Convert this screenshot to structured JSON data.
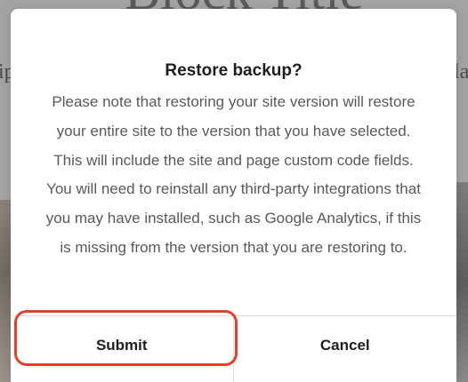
{
  "background": {
    "heading_fragment": "Block Title",
    "left_text_fragment": "ip",
    "right_text_fragment": "la"
  },
  "dialog": {
    "title": "Restore backup?",
    "message": "Please note that restoring your site version will restore your entire site to the version that you have selected. This will include the site and page custom code fields. You will need to reinstall any third-party integrations that you may have installed, such as Google Analytics, if this is missing from the version that you are restoring to.",
    "submit_label": "Submit",
    "cancel_label": "Cancel"
  },
  "colors": {
    "highlight": "#e0412d",
    "title_text": "#1e1e1e",
    "body_text": "#595959",
    "overlay": "#a3a3a3"
  }
}
